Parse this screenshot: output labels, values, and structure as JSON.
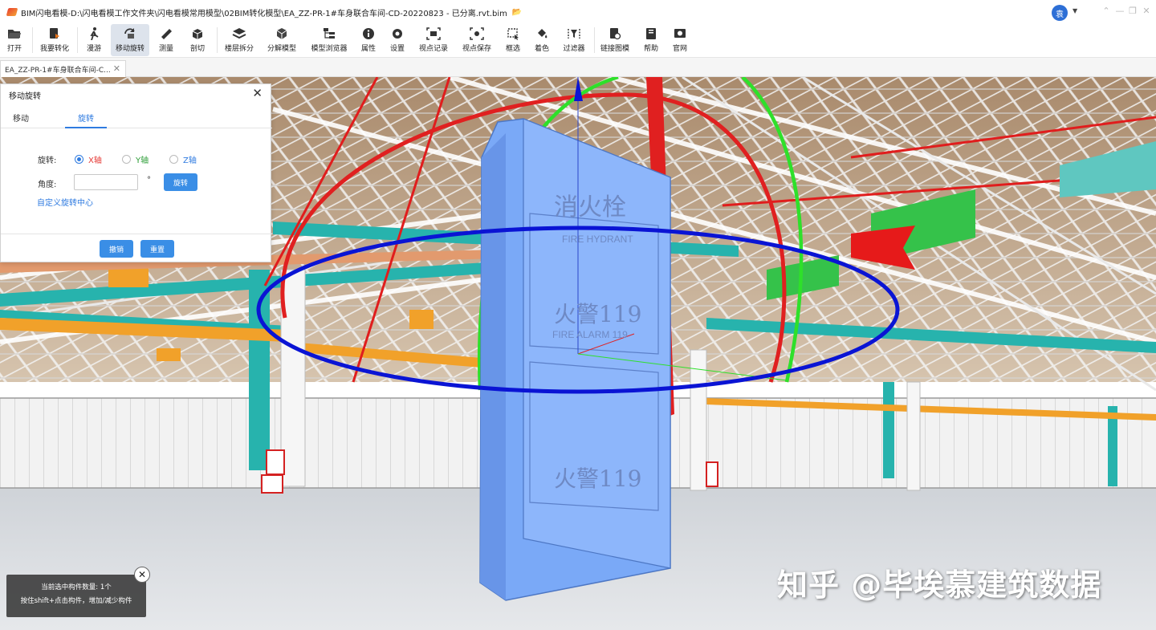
{
  "window": {
    "title": "BIM闪电看模-D:\\闪电看模工作文件夹\\闪电看模常用模型\\02BIM转化模型\\EA_ZZ-PR-1#车身联合车间-CD-20220823 - 已分离.rvt.bim",
    "user_avatar": "袁"
  },
  "toolbar": [
    {
      "label": "打开",
      "icon": "folder-open-icon"
    },
    {
      "label": "我要转化",
      "icon": "convert-icon"
    },
    {
      "label": "漫游",
      "icon": "walk-icon"
    },
    {
      "label": "移动旋转",
      "icon": "move-rotate-icon",
      "active": true
    },
    {
      "label": "测量",
      "icon": "ruler-icon"
    },
    {
      "label": "剖切",
      "icon": "section-box-icon"
    },
    {
      "label": "楼层拆分",
      "icon": "layers-icon"
    },
    {
      "label": "分解模型",
      "icon": "explode-cube-icon"
    },
    {
      "label": "模型浏览器",
      "icon": "tree-icon"
    },
    {
      "label": "属性",
      "icon": "info-icon"
    },
    {
      "label": "设置",
      "icon": "gear-icon"
    },
    {
      "label": "视点记录",
      "icon": "viewpoint-record-icon"
    },
    {
      "label": "视点保存",
      "icon": "viewpoint-save-icon"
    },
    {
      "label": "框选",
      "icon": "box-select-icon"
    },
    {
      "label": "着色",
      "icon": "paint-bucket-icon"
    },
    {
      "label": "过滤器",
      "icon": "filter-icon"
    },
    {
      "label": "链接图模",
      "icon": "link-drawing-icon"
    },
    {
      "label": "帮助",
      "icon": "book-icon"
    },
    {
      "label": "官网",
      "icon": "website-icon"
    }
  ],
  "doc_tab": {
    "label": "EA_ZZ-PR-1#车身联合车间-C..."
  },
  "dialog": {
    "title": "移动旋转",
    "tabs": [
      "移动",
      "旋转"
    ],
    "active_tab": "旋转",
    "rotate_label": "旋转:",
    "axes": [
      {
        "label": "X轴",
        "color": "#e53935",
        "selected": true
      },
      {
        "label": "Y轴",
        "color": "#2e9e38",
        "selected": false
      },
      {
        "label": "Z轴",
        "color": "#2f7be0",
        "selected": false
      }
    ],
    "angle_label": "角度:",
    "angle_value": "",
    "degree_unit": "°",
    "rotate_button": "旋转",
    "custom_center_link": "自定义旋转中心",
    "undo_button": "撤销",
    "reset_button": "重置"
  },
  "scene": {
    "panel_top_text": "消火栓",
    "panel_top_sub": "FIRE HYDRANT",
    "panel_mid_text": "火警119",
    "panel_mid_sub": "FIRE ALARM 119",
    "panel_bottom_text": "火警119"
  },
  "toast": {
    "line1": "当前选中构件数量: 1个",
    "line2": "按住shift+点击构件，增加/减少构件"
  },
  "watermark": "知乎 @毕埃慕建筑数据"
}
